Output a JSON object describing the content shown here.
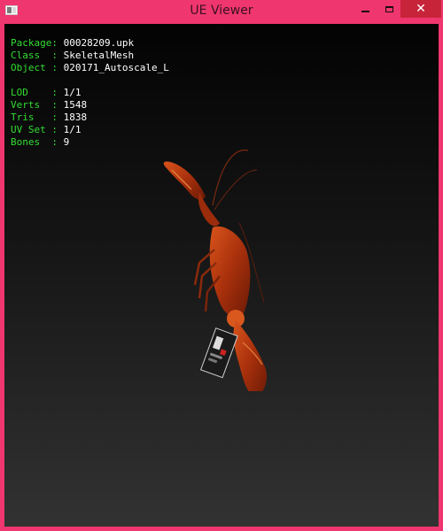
{
  "window": {
    "title": "UE Viewer",
    "close_glyph": "✕",
    "accent": "#f0366f",
    "close_color": "#c7243a"
  },
  "info": {
    "mesh": [
      {
        "key": "Package",
        "value": "00028209.upk"
      },
      {
        "key": "Class  ",
        "value": "SkeletalMesh"
      },
      {
        "key": "Object ",
        "value": "020171_Autoscale_L"
      }
    ],
    "stats": [
      {
        "key": "LOD    ",
        "value": "1/1"
      },
      {
        "key": "Verts  ",
        "value": "1548"
      },
      {
        "key": "Tris   ",
        "value": "1838"
      },
      {
        "key": "UV Set ",
        "value": "1/1"
      },
      {
        "key": "Bones  ",
        "value": "9"
      }
    ],
    "key_color": "#33dd33",
    "value_color": "#ffffff"
  },
  "model": {
    "subject": "red lobster with tag",
    "color": "#b83a10"
  }
}
